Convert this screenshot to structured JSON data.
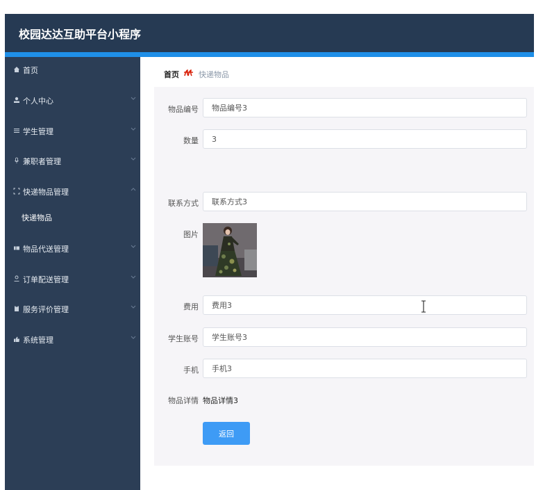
{
  "header": {
    "title": "校园达达互助平台小程序"
  },
  "sidebar": {
    "items": [
      {
        "label": "首页",
        "icon": "home-icon"
      },
      {
        "label": "个人中心",
        "icon": "person-icon"
      },
      {
        "label": "学生管理",
        "icon": "list-icon"
      },
      {
        "label": "兼职者管理",
        "icon": "mic-icon"
      },
      {
        "label": "快递物品管理",
        "icon": "frame-icon",
        "expanded": true
      },
      {
        "label": "物品代送管理",
        "icon": "ticket-icon"
      },
      {
        "label": "订单配送管理",
        "icon": "user-icon"
      },
      {
        "label": "服务评价管理",
        "icon": "clipboard-icon"
      },
      {
        "label": "系统管理",
        "icon": "thumb-icon"
      }
    ],
    "submenu": {
      "label": "快递物品"
    }
  },
  "breadcrumb": {
    "home": "首页",
    "current": "快递物品"
  },
  "form": {
    "item_no": {
      "label": "物品编号",
      "value": "物品编号3"
    },
    "quantity": {
      "label": "数量",
      "value": "3"
    },
    "contact": {
      "label": "联系方式",
      "value": "联系方式3"
    },
    "image": {
      "label": "图片"
    },
    "fee": {
      "label": "费用",
      "value": "费用3"
    },
    "student_account": {
      "label": "学生账号",
      "value": "学生账号3"
    },
    "phone": {
      "label": "手机",
      "value": "手机3"
    },
    "detail": {
      "label": "物品详情",
      "value": "物品详情3"
    },
    "back_label": "返回"
  },
  "colors": {
    "header_bg": "#263a53",
    "accent": "#1f8fe8",
    "sidebar_bg": "#2c3e56",
    "button_bg": "#3e9bf5"
  }
}
